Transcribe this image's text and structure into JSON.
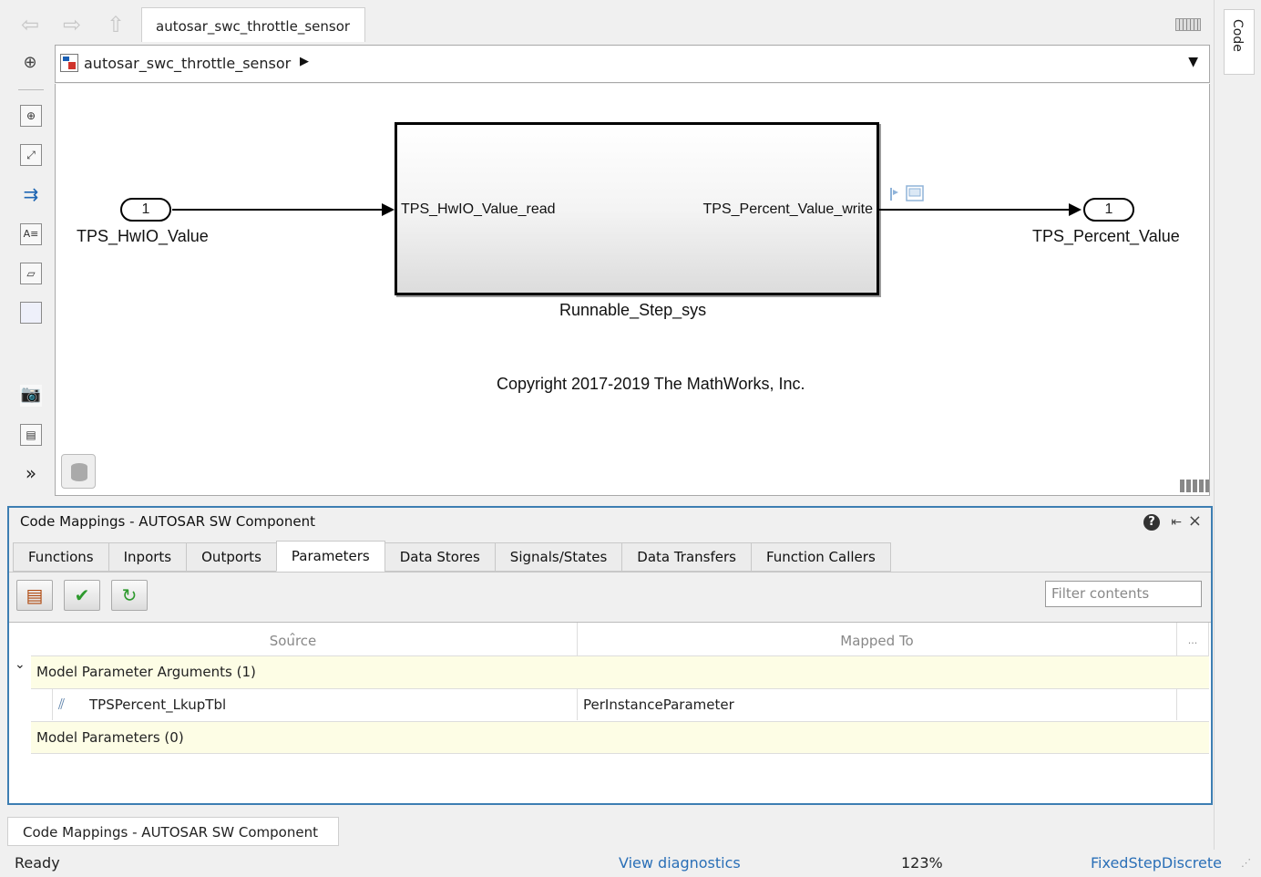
{
  "window": {
    "model_tab": "autosar_swc_throttle_sensor",
    "code_side_tab": "Code"
  },
  "address": {
    "path": "autosar_swc_throttle_sensor"
  },
  "palette": {
    "icons": [
      "zoom-icon",
      "fit-view-icon",
      "signal-arrow-icon",
      "text-annotation-icon",
      "image-annotation-icon",
      "area-icon",
      "camera-icon",
      "model-browser-icon",
      "expand-icon"
    ]
  },
  "canvas": {
    "inport": {
      "number": "1",
      "name": "TPS_HwIO_Value"
    },
    "outport": {
      "number": "1",
      "name": "TPS_Percent_Value"
    },
    "subsystem": {
      "name": "Runnable_Step_sys",
      "input_label": "TPS_HwIO_Value_read",
      "output_label": "TPS_Percent_Value_write"
    },
    "copyright": "Copyright 2017-2019 The MathWorks, Inc."
  },
  "code_mappings": {
    "title": "Code Mappings - AUTOSAR SW Component",
    "tabs": [
      {
        "label": "Functions"
      },
      {
        "label": "Inports"
      },
      {
        "label": "Outports"
      },
      {
        "label": "Parameters",
        "active": true
      },
      {
        "label": "Data Stores"
      },
      {
        "label": "Signals/States"
      },
      {
        "label": "Data Transfers"
      },
      {
        "label": "Function Callers"
      }
    ],
    "filter_placeholder": "Filter contents",
    "columns": {
      "source": "Source",
      "mapped_to": "Mapped To",
      "more": "..."
    },
    "groups": [
      {
        "label": "Model Parameter Arguments (1)",
        "rows": [
          {
            "source": "TPSPercent_LkupTbl",
            "mapped_to": "PerInstanceParameter"
          }
        ]
      },
      {
        "label": "Model Parameters (0)",
        "rows": []
      }
    ]
  },
  "bottom_tab": "Code Mappings - AUTOSAR SW Component",
  "status": {
    "state": "Ready",
    "diagnostics": "View diagnostics",
    "zoom": "123%",
    "solver": "FixedStepDiscrete"
  },
  "colors": {
    "panel_border": "#3d7eb2",
    "group_row": "#fdfde5",
    "link": "#2a6fb7"
  }
}
